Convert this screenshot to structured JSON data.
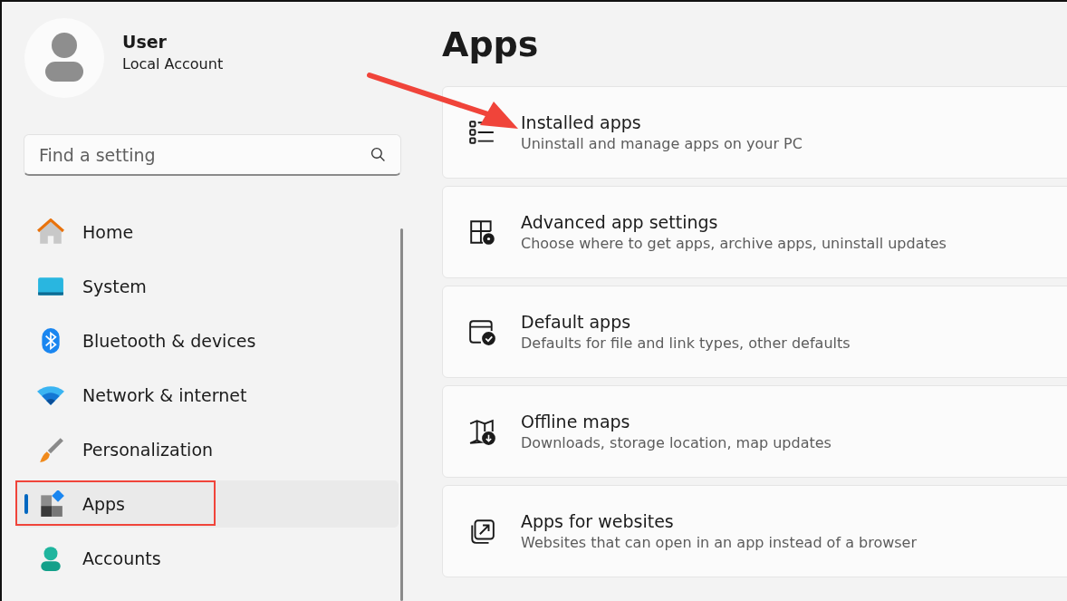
{
  "user": {
    "name": "User",
    "account": "Local Account"
  },
  "search": {
    "placeholder": "Find a setting"
  },
  "nav": [
    {
      "kind": "home",
      "label": "Home",
      "selected": false,
      "annotated": false
    },
    {
      "kind": "system",
      "label": "System",
      "selected": false,
      "annotated": false
    },
    {
      "kind": "bluetooth",
      "label": "Bluetooth & devices",
      "selected": false,
      "annotated": false
    },
    {
      "kind": "network",
      "label": "Network & internet",
      "selected": false,
      "annotated": false
    },
    {
      "kind": "personalization",
      "label": "Personalization",
      "selected": false,
      "annotated": false
    },
    {
      "kind": "apps",
      "label": "Apps",
      "selected": true,
      "annotated": true
    },
    {
      "kind": "accounts",
      "label": "Accounts",
      "selected": false,
      "annotated": false
    }
  ],
  "page": {
    "title": "Apps",
    "pointer_arrow": true
  },
  "cards": [
    {
      "kind": "list",
      "title": "Installed apps",
      "subtitle": "Uninstall and manage apps on your PC"
    },
    {
      "kind": "gear",
      "title": "Advanced app settings",
      "subtitle": "Choose where to get apps, archive apps, uninstall updates"
    },
    {
      "kind": "check",
      "title": "Default apps",
      "subtitle": "Defaults for file and link types, other defaults"
    },
    {
      "kind": "map",
      "title": "Offline maps",
      "subtitle": "Downloads, storage location, map updates"
    },
    {
      "kind": "open",
      "title": "Apps for websites",
      "subtitle": "Websites that can open in an app instead of a browser"
    }
  ]
}
